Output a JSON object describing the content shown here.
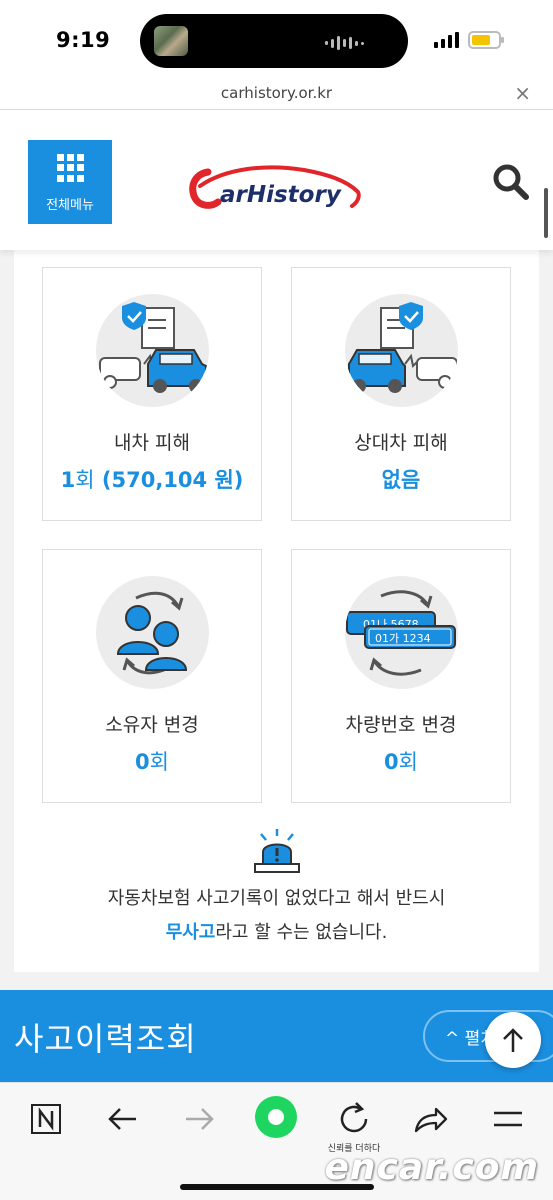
{
  "status_bar": {
    "time": "9:19"
  },
  "browser": {
    "url": "carhistory.or.kr",
    "close_label": "×"
  },
  "header": {
    "menu_label": "전체메뉴",
    "logo_text": "CarHistory"
  },
  "cards": [
    {
      "title": "내차 피해",
      "count": "1",
      "count_unit": "회",
      "amount": " (570,104 원)"
    },
    {
      "title": "상대차 피해",
      "value": "없음"
    },
    {
      "title": "소유자 변경",
      "count": "0",
      "count_unit": "회"
    },
    {
      "title": "차량번호 변경",
      "count": "0",
      "count_unit": "회",
      "plate_front": "01가 1234",
      "plate_back": "01나 5678"
    }
  ],
  "notice": {
    "line1": "자동차보험 사고기록이 없었다고 해서 반드시",
    "highlight": "무사고",
    "line2_rest": "라고 할 수는 없습니다."
  },
  "banner": {
    "title": "사고이력조회",
    "expand_label": "^ 펼치기"
  },
  "toolbar": {
    "refresh_label": "신뢰를 더하다"
  },
  "watermark": "encar.com",
  "colors": {
    "accent": "#1a8fe0",
    "logo_red": "#e0262b",
    "logo_navy": "#1d2f6b",
    "toolbar_green": "#1ed65f"
  }
}
